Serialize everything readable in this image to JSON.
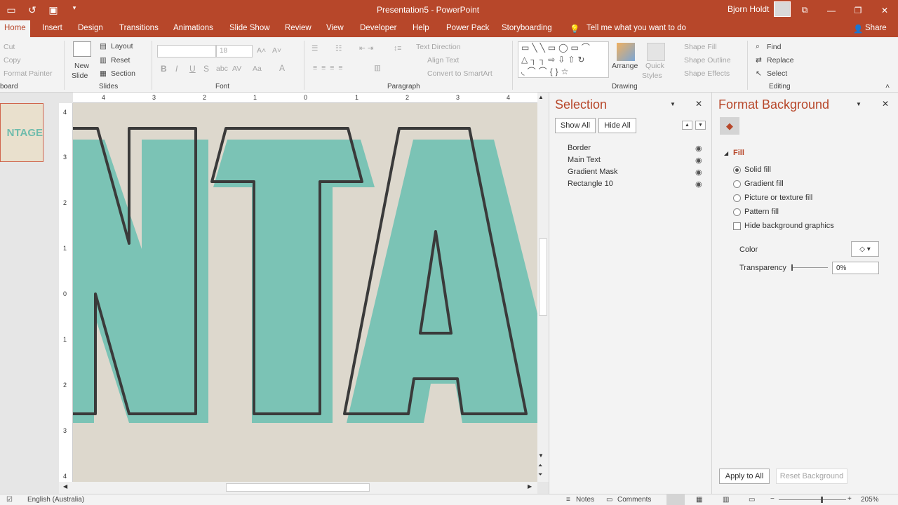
{
  "app": {
    "title": "Presentation5  -  PowerPoint",
    "user": "Bjorn Holdt",
    "share_label": "Share"
  },
  "qat": {
    "save_icon": "save-icon",
    "undo_icon": "undo-icon",
    "start_icon": "start-from-beginning-icon",
    "customize_icon": "customize-qat-icon"
  },
  "tabs": [
    "Home",
    "Insert",
    "Design",
    "Transitions",
    "Animations",
    "Slide Show",
    "Review",
    "View",
    "Developer",
    "Help",
    "Power Pack",
    "Storyboarding"
  ],
  "tell_me": "Tell me what you want to do",
  "ribbon": {
    "clipboard": {
      "cut": "Cut",
      "copy": "Copy",
      "format_painter": "Format Painter",
      "label": "board"
    },
    "slides": {
      "new_slide_1": "New",
      "new_slide_2": "Slide",
      "layout": "Layout",
      "reset": "Reset",
      "section": "Section",
      "label": "Slides"
    },
    "font": {
      "size": "18",
      "label": "Font",
      "bold": "B",
      "italic": "I",
      "underline": "U",
      "strike": "S",
      "shadow": "abc",
      "spacing": "AV",
      "case": "Aa",
      "color": "A"
    },
    "paragraph": {
      "text_direction": "Text Direction",
      "align_text": "Align Text",
      "convert_smartart": "Convert to SmartArt",
      "label": "Paragraph"
    },
    "drawing": {
      "arrange": "Arrange",
      "quick_styles_1": "Quick",
      "quick_styles_2": "Styles",
      "shape_fill": "Shape Fill",
      "shape_outline": "Shape Outline",
      "shape_effects": "Shape Effects",
      "label": "Drawing"
    },
    "editing": {
      "find": "Find",
      "replace": "Replace",
      "select": "Select",
      "label": "Editing"
    }
  },
  "thumbnail_text": "NTAGE",
  "slide": {
    "text": "NTA",
    "fill_color": "#7bc3b5",
    "outline_color": "#3a3a3a",
    "bg_color": "#ddd8cd"
  },
  "ruler": {
    "h_ticks": [
      "4",
      "3",
      "2",
      "1",
      "0",
      "1",
      "2",
      "3",
      "4"
    ],
    "v_ticks": [
      "4",
      "3",
      "2",
      "1",
      "0",
      "1",
      "2",
      "3",
      "4"
    ]
  },
  "selection": {
    "title": "Selection",
    "show_all": "Show All",
    "hide_all": "Hide All",
    "items": [
      "Border",
      "Main Text",
      "Gradient Mask",
      "Rectangle 10"
    ]
  },
  "format_bg": {
    "title": "Format Background",
    "section": "Fill",
    "options": [
      "Solid fill",
      "Gradient fill",
      "Picture or texture fill",
      "Pattern fill"
    ],
    "selected": "Solid fill",
    "hide_graphics": "Hide background graphics",
    "color_label": "Color",
    "transparency_label": "Transparency",
    "transparency_value": "0%",
    "apply_all": "Apply to All",
    "reset_bg": "Reset Background"
  },
  "status": {
    "language": "English (Australia)",
    "notes": "Notes",
    "comments": "Comments",
    "zoom": "205%"
  },
  "colors": {
    "accent": "#b7472a"
  }
}
